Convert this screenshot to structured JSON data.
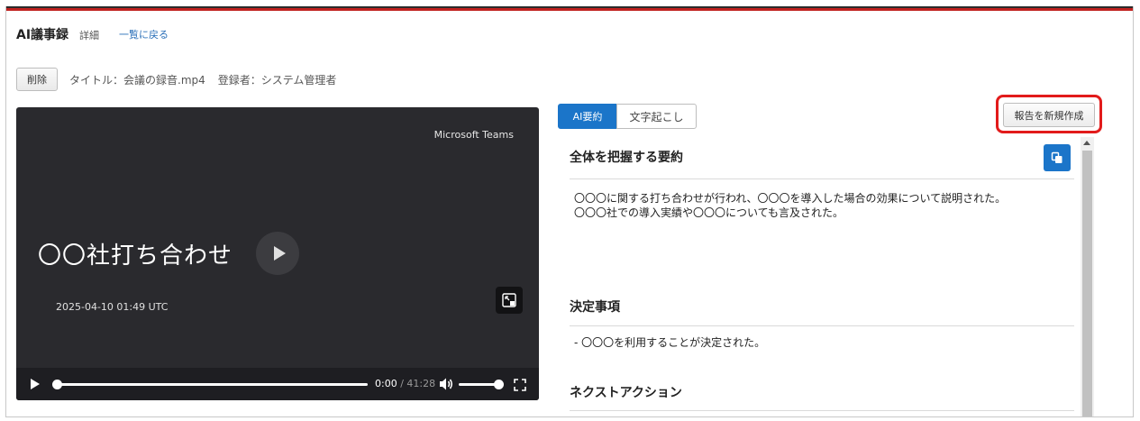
{
  "header": {
    "title": "AI議事録",
    "subtitle": "詳細",
    "back_link": "一覧に戻る"
  },
  "toolbar": {
    "delete_label": "削除",
    "title_meta": "タイトル：会議の録音.mp4",
    "registrant_meta": "登録者：システム管理者"
  },
  "video": {
    "brand": "Microsoft Teams",
    "title": "〇〇社打ち合わせ",
    "date": "2025-04-10 01:49 UTC",
    "time_current": "0:00",
    "time_separator": "/",
    "time_total": "41:28",
    "progress_fraction": 0.0,
    "volume_fraction": 1.0
  },
  "tabs": {
    "ai_summary": "AI要約",
    "transcript": "文字起こし",
    "active": "AI要約"
  },
  "actions": {
    "new_report_label": "報告を新規作成"
  },
  "summary": {
    "overall_heading": "全体を把握する要約",
    "overall_lines": [
      "〇〇〇に関する打ち合わせが行われ、〇〇〇を導入した場合の効果について説明された。",
      "〇〇〇社での導入実績や〇〇〇についても言及された。"
    ],
    "decisions_heading": "決定事項",
    "decisions_line": "- 〇〇〇を利用することが決定された。",
    "next_heading": "ネクストアクション"
  },
  "colors": {
    "accent": "#1b75c9",
    "brand_red": "#c0211f",
    "highlight": "#e21b1b",
    "video_bg": "#2a2a2e"
  }
}
